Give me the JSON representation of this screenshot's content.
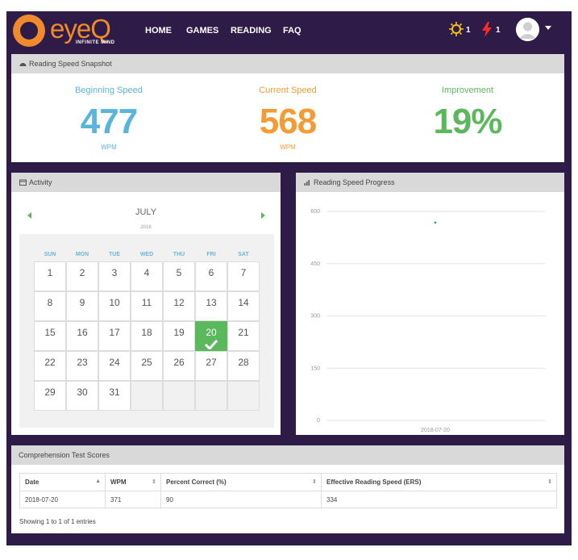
{
  "brand": {
    "name": "eyeQ",
    "tagline": "INFINITE MIND"
  },
  "nav": {
    "items": [
      "HOME",
      "GAMES",
      "READING",
      "FAQ"
    ]
  },
  "header": {
    "sun_count": "1",
    "bolt_count": "1"
  },
  "snapshot": {
    "title": "Reading Speed Snapshot",
    "beginning": {
      "label": "Beginning Speed",
      "value": "477",
      "unit": "WPM",
      "color": "#5bb4dc"
    },
    "current": {
      "label": "Current Speed",
      "value": "568",
      "unit": "WPM",
      "color": "#f39c35"
    },
    "improvement": {
      "label": "Improvement",
      "value": "19%",
      "color": "#5cb85c"
    }
  },
  "activity": {
    "title": "Activity",
    "month": "JULY",
    "year": "2018",
    "weekdays": [
      "SUN",
      "MON",
      "TUE",
      "WED",
      "THU",
      "FRI",
      "SAT"
    ],
    "weeks": [
      [
        "1",
        "2",
        "3",
        "4",
        "5",
        "6",
        "7"
      ],
      [
        "8",
        "9",
        "10",
        "11",
        "12",
        "13",
        "14"
      ],
      [
        "15",
        "16",
        "17",
        "18",
        "19",
        "20",
        "21"
      ],
      [
        "22",
        "23",
        "24",
        "25",
        "26",
        "27",
        "28"
      ],
      [
        "29",
        "30",
        "31",
        "",
        "",
        "",
        ""
      ]
    ],
    "completed_day": "20"
  },
  "progress": {
    "title": "Reading Speed Progress",
    "chart_data": {
      "type": "scatter",
      "x": [
        "2018-07-20"
      ],
      "y": [
        568
      ],
      "ylim": [
        0,
        600
      ],
      "yticks": [
        "600",
        "450",
        "300",
        "150",
        "0"
      ],
      "xticks": [
        "2018-07-20"
      ],
      "grid": true
    }
  },
  "comprehension": {
    "title": "Comprehension Test Scores",
    "columns": [
      "Date",
      "WPM",
      "Percent Correct (%)",
      "Effective Reading Speed (ERS)"
    ],
    "rows": [
      [
        "2018-07-20",
        "371",
        "90",
        "334"
      ]
    ],
    "footer": "Showing 1 to 1 of 1 entries"
  }
}
